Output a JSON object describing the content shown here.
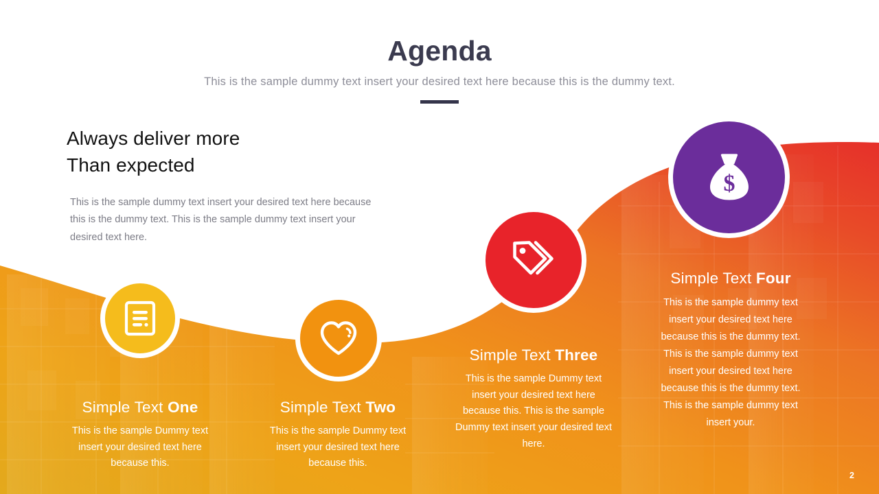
{
  "header": {
    "title": "Agenda",
    "subtitle": "This is the sample dummy text insert your desired text here because this is the dummy text."
  },
  "intro": {
    "heading_line1": "Always deliver more",
    "heading_line2": "Than expected",
    "body": "This is the sample dummy text insert your desired text here because this is the dummy text. This is the sample dummy text insert your desired text here."
  },
  "steps": [
    {
      "title_prefix": "Simple Text ",
      "title_emphasis": "One",
      "body": "This is the sample Dummy text insert your desired text here because this.",
      "icon": "document-icon",
      "color": "#f5bc1c"
    },
    {
      "title_prefix": "Simple Text ",
      "title_emphasis": "Two",
      "body": "This is the sample Dummy text insert your desired text here because this.",
      "icon": "heart-icon",
      "color": "#f2920f"
    },
    {
      "title_prefix": "Simple Text ",
      "title_emphasis": "Three",
      "body": "This is the sample Dummy text insert your desired text here because this. This is the sample Dummy text insert your desired text here.",
      "icon": "tags-icon",
      "color": "#e8232a"
    },
    {
      "title_prefix": "Simple Text ",
      "title_emphasis": "Four",
      "body": "This is the sample dummy text insert your desired text here because this is the dummy text. This is the sample dummy text insert your desired text here because this is the dummy text. This is the sample dummy text insert your.",
      "icon": "money-bag-icon",
      "color": "#6b2d9b"
    }
  ],
  "footer": {
    "page_number": "2"
  },
  "theme": {
    "title_color": "#3b3b4f",
    "subtitle_color": "#8d8d98",
    "rule_color": "#34344a",
    "wave_start": "#e8a81e",
    "wave_mid": "#ef8c1c",
    "wave_end": "#e8322a"
  }
}
